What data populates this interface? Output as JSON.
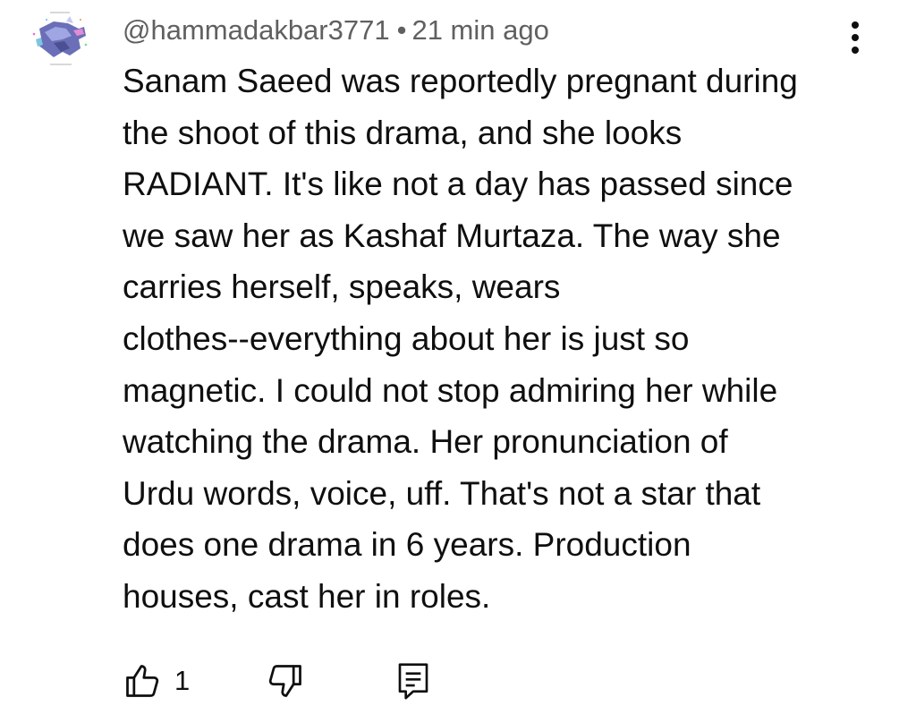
{
  "comment": {
    "author": "@hammadakbar3771",
    "separator": "•",
    "timestamp": "21 min ago",
    "body_lines": [
      "Sanam Saeed was reportedly pregnant during",
      "the shoot of this drama, and she looks",
      "RADIANT. It's like not a day has passed since",
      "we saw her as Kashaf Murtaza. The way she",
      "carries herself, speaks, wears",
      "clothes--everything about her is just so",
      "magnetic. I could not stop admiring her while",
      "watching the drama. Her pronunciation of",
      "Urdu words, voice, uff. That's not a star that",
      "does one drama in 6 years. Production",
      "houses, cast her in roles."
    ],
    "like_count": "1"
  },
  "icons": {
    "avatar": "wolf-avatar-icon",
    "menu": "more-vertical-icon",
    "like": "thumbs-up-icon",
    "dislike": "thumbs-down-icon",
    "reply": "reply-comment-icon"
  }
}
